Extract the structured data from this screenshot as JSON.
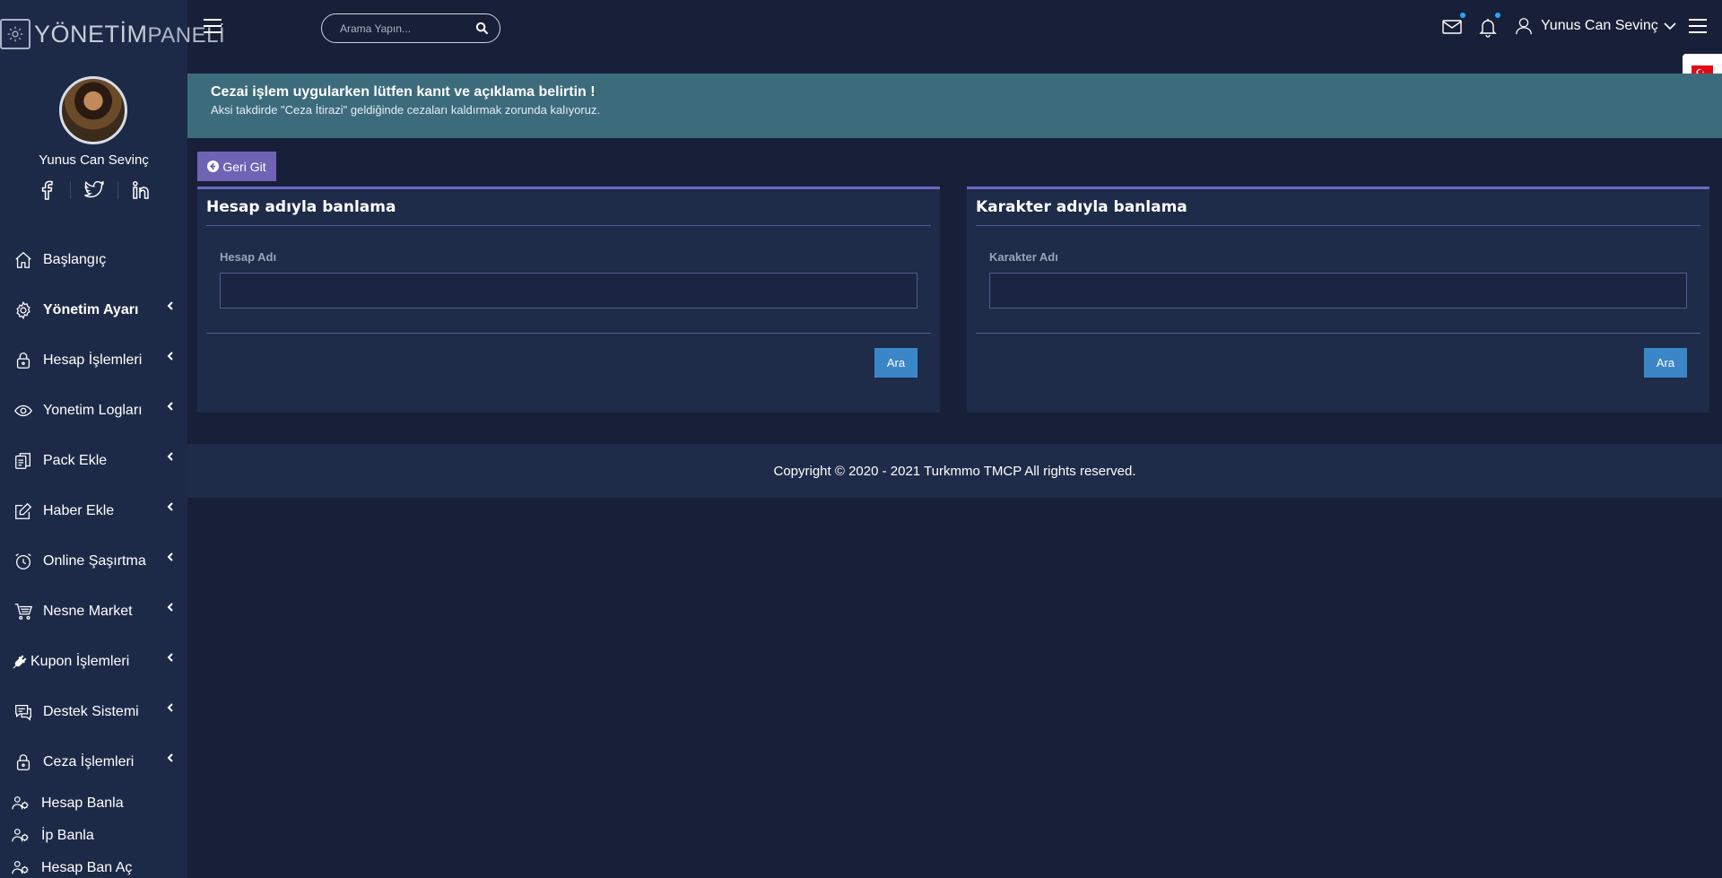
{
  "logo": {
    "part1": "YÖNETİM",
    "part2": "PANELİ"
  },
  "profile": {
    "name": "Yunus Can Sevinç"
  },
  "search": {
    "placeholder": "Arama Yapın..."
  },
  "header": {
    "user_name": "Yunus Can Sevinç"
  },
  "sidebar": {
    "items": [
      {
        "label": "Başlangıç",
        "icon": "home-icon"
      },
      {
        "label": "Yönetim Ayarı",
        "icon": "gear-icon"
      },
      {
        "label": "Hesap İşlemleri",
        "icon": "lock-icon"
      },
      {
        "label": "Yonetim Logları",
        "icon": "eye-icon"
      },
      {
        "label": "Pack Ekle",
        "icon": "files-icon"
      },
      {
        "label": "Haber Ekle",
        "icon": "edit-icon"
      },
      {
        "label": "Online Şaşırtma",
        "icon": "alarm-clock-icon"
      },
      {
        "label": "Nesne Market",
        "icon": "cart-icon"
      },
      {
        "label": "Kupon İşlemleri",
        "icon": "plug-icon"
      },
      {
        "label": "Destek Sistemi",
        "icon": "chat-icon"
      },
      {
        "label": "Ceza İşlemleri",
        "icon": "lock-icon"
      }
    ],
    "sub_items": [
      {
        "label": "Hesap Banla",
        "icon": "users-gear-icon"
      },
      {
        "label": "İp Banla",
        "icon": "users-gear-icon"
      },
      {
        "label": "Hesap Ban Aç",
        "icon": "users-gear-icon"
      }
    ]
  },
  "alert": {
    "title": "Cezai işlem uygularken lütfen kanıt ve açıklama belirtin !",
    "text": "Aksi takdirde \"Ceza İtirazi\" geldiğinde cezaları kaldırmak zorunda kalıyoruz."
  },
  "back_button": {
    "label": "Geri Git"
  },
  "cards": {
    "account": {
      "title": "Hesap adıyla banlama",
      "field_label": "Hesap Adı",
      "value": "",
      "button": "Ara"
    },
    "character": {
      "title": "Karakter adıyla banlama",
      "field_label": "Karakter Adı",
      "value": "",
      "button": "Ara"
    }
  },
  "footer": {
    "copyright": "Copyright © 2020 - 2021 Turkmmo TMCP All rights reserved."
  },
  "colors": {
    "accent": "#6a67c3",
    "button_blue": "#3b86c6",
    "alert_bg": "#3c6b7c",
    "sidebar_bg": "#1d2a47",
    "page_bg": "#172038"
  }
}
